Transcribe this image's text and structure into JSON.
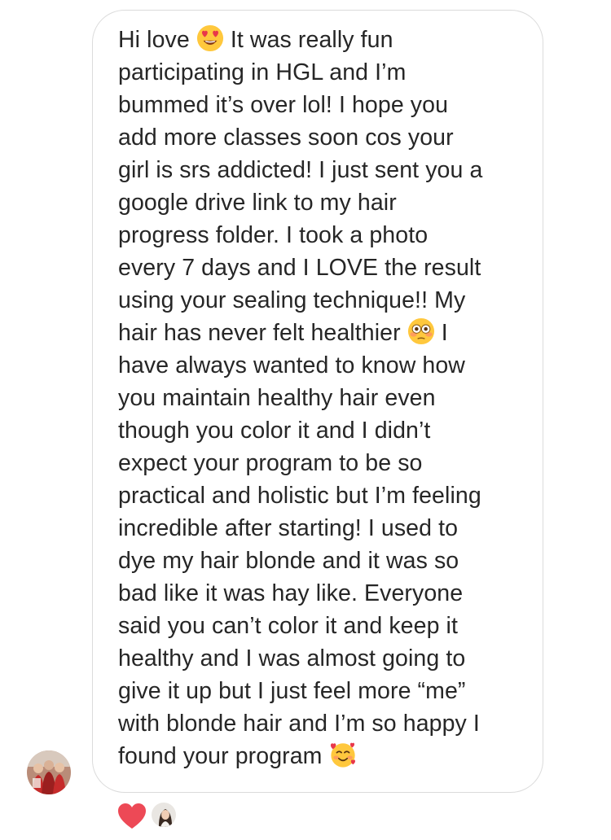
{
  "message": {
    "text_1": "Hi love ",
    "emoji_1": "heart-eyes-emoji",
    "text_2": " It was really fun\nparticipating in HGL and I’m\nbummed it’s over lol! I hope you\nadd more classes soon cos your\ngirl is srs addicted! I just sent you a\ngoogle drive link to my hair\nprogress folder. I took a photo\nevery 7 days and I LOVE the result\nusing your sealing technique!! My\nhair has never felt healthier ",
    "emoji_2": "flushed-face-emoji",
    "text_3": " I\nhave always wanted to know how\nyou maintain healthy hair even\nthough you color it and I didn’t\nexpect your program to be so\npractical and holistic but I’m feeling\nincredible after starting! I used to\ndye my hair blonde and it was so\nbad like it was hay like. Everyone\nsaid you can’t color it and keep it\nhealthy and I was almost going to\ngive it up but I just feel more “me”\nwith blonde hair and I’m so happy I\nfound your program ",
    "emoji_3": "smiling-face-with-hearts-emoji"
  },
  "sender_avatar": "group-photo-avatar",
  "reactions": {
    "icon": "heart-icon",
    "color": "#ed4956",
    "reactor_avatar": "profile-photo-avatar"
  },
  "colors": {
    "text": "#262626",
    "bubble_border": "#dbdbdb",
    "emoji_yellow": "#ffc83d"
  }
}
